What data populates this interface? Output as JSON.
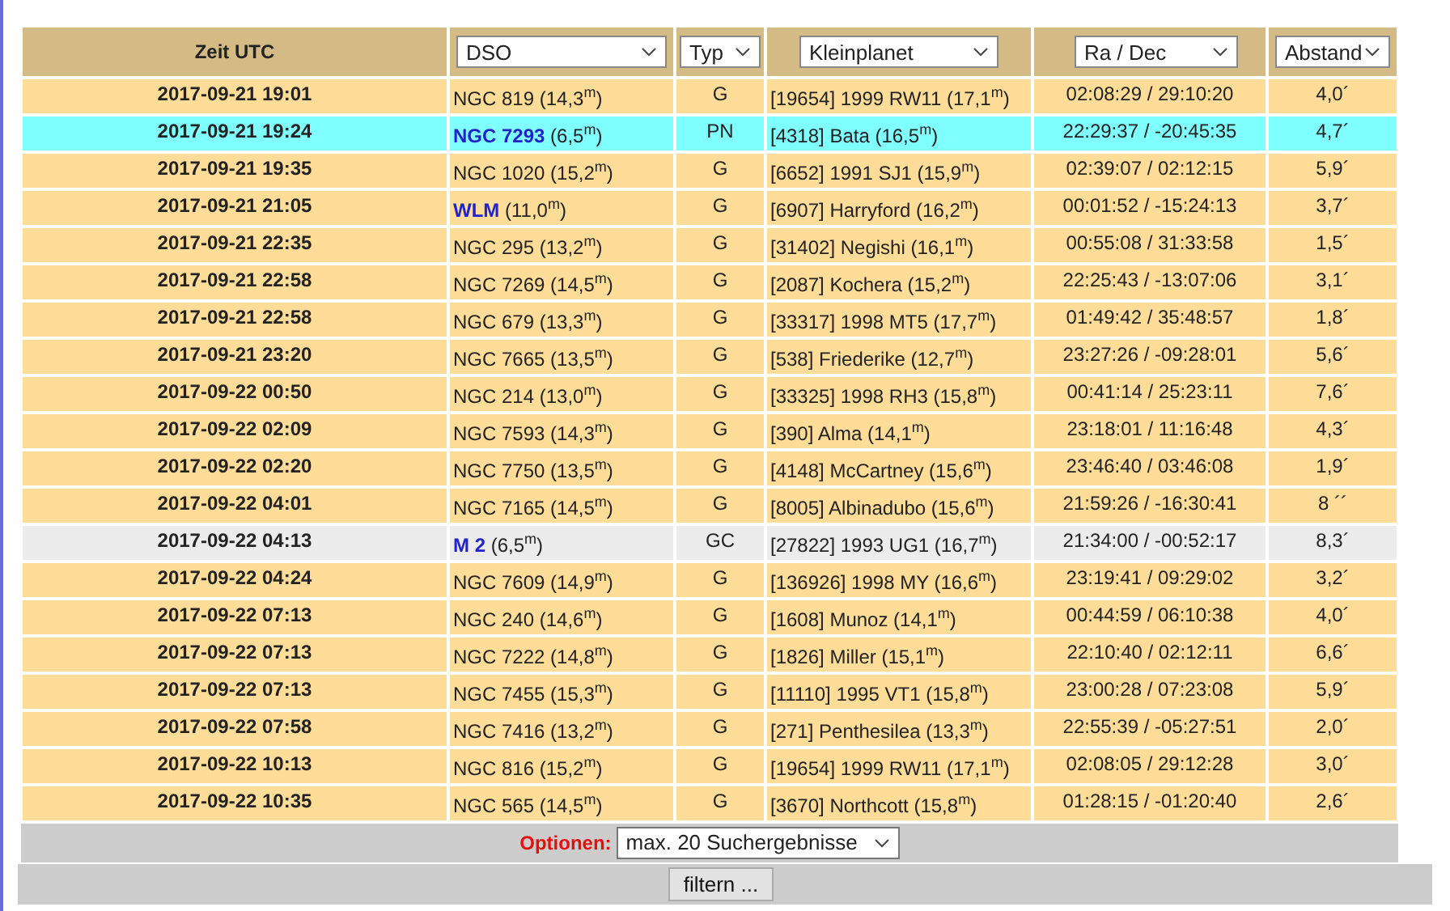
{
  "table": {
    "columns": [
      {
        "label": "Zeit UTC",
        "kind": "text"
      },
      {
        "label": "DSO",
        "kind": "select"
      },
      {
        "label": "Typ",
        "kind": "select"
      },
      {
        "label": "Kleinplanet",
        "kind": "select"
      },
      {
        "label": "Ra / Dec",
        "kind": "select"
      },
      {
        "label": "Abstand",
        "kind": "select"
      }
    ],
    "rows": [
      {
        "color": "#ffdd99",
        "time": "2017-09-21 19:01",
        "dso": {
          "name": "NGC 819",
          "mag": "(14,3$^{m}$)",
          "link": false
        },
        "type": "G",
        "planet": "[19654] 1999 RW11 (17,1$^{m}$)",
        "radec": "02:08:29 / 29:10:20",
        "distance": "4,0´"
      },
      {
        "color": "#80ffff",
        "time": "2017-09-21 19:24",
        "dso": {
          "name": "NGC 7293",
          "mag": "(6,5$^{m}$)",
          "link": true
        },
        "type": "PN",
        "planet": "[4318] Bata (16,5$^{m}$)",
        "radec": "22:29:37 / -20:45:35",
        "distance": "4,7´"
      },
      {
        "color": "#ffdd99",
        "time": "2017-09-21 19:35",
        "dso": {
          "name": "NGC 1020",
          "mag": "(15,2$^{m}$)",
          "link": false
        },
        "type": "G",
        "planet": "[6652] 1991 SJ1 (15,9$^{m}$)",
        "radec": "02:39:07 / 02:12:15",
        "distance": "5,9´"
      },
      {
        "color": "#ffdd99",
        "time": "2017-09-21 21:05",
        "dso": {
          "name": "WLM",
          "mag": "(11,0$^{m}$)",
          "link": true
        },
        "type": "G",
        "planet": "[6907] Harryford (16,2$^{m}$)",
        "radec": "00:01:52 / -15:24:13",
        "distance": "3,7´"
      },
      {
        "color": "#ffdd99",
        "time": "2017-09-21 22:35",
        "dso": {
          "name": "NGC 295",
          "mag": "(13,2$^{m}$)",
          "link": false
        },
        "type": "G",
        "planet": "[31402] Negishi (16,1$^{m}$)",
        "radec": "00:55:08 / 31:33:58",
        "distance": "1,5´"
      },
      {
        "color": "#ffdd99",
        "time": "2017-09-21 22:58",
        "dso": {
          "name": "NGC 7269",
          "mag": "(14,5$^{m}$)",
          "link": false
        },
        "type": "G",
        "planet": "[2087] Kochera (15,2$^{m}$)",
        "radec": "22:25:43 / -13:07:06",
        "distance": "3,1´"
      },
      {
        "color": "#ffdd99",
        "time": "2017-09-21 22:58",
        "dso": {
          "name": "NGC 679",
          "mag": "(13,3$^{m}$)",
          "link": false
        },
        "type": "G",
        "planet": "[33317] 1998 MT5 (17,7$^{m}$)",
        "radec": "01:49:42 / 35:48:57",
        "distance": "1,8´"
      },
      {
        "color": "#ffdd99",
        "time": "2017-09-21 23:20",
        "dso": {
          "name": "NGC 7665",
          "mag": "(13,5$^{m}$)",
          "link": false
        },
        "type": "G",
        "planet": "[538] Friederike (12,7$^{m}$)",
        "radec": "23:27:26 / -09:28:01",
        "distance": "5,6´"
      },
      {
        "color": "#ffdd99",
        "time": "2017-09-22 00:50",
        "dso": {
          "name": "NGC 214",
          "mag": "(13,0$^{m}$)",
          "link": false
        },
        "type": "G",
        "planet": "[33325] 1998 RH3 (15,8$^{m}$)",
        "radec": "00:41:14 / 25:23:11",
        "distance": "7,6´"
      },
      {
        "color": "#ffdd99",
        "time": "2017-09-22 02:09",
        "dso": {
          "name": "NGC 7593",
          "mag": "(14,3$^{m}$)",
          "link": false
        },
        "type": "G",
        "planet": "[390] Alma (14,1$^{m}$)",
        "radec": "23:18:01 / 11:16:48",
        "distance": "4,3´"
      },
      {
        "color": "#ffdd99",
        "time": "2017-09-22 02:20",
        "dso": {
          "name": "NGC 7750",
          "mag": "(13,5$^{m}$)",
          "link": false
        },
        "type": "G",
        "planet": "[4148] McCartney (15,6$^{m}$)",
        "radec": "23:46:40 / 03:46:08",
        "distance": "1,9´"
      },
      {
        "color": "#ffdd99",
        "time": "2017-09-22 04:01",
        "dso": {
          "name": "NGC 7165",
          "mag": "(14,5$^{m}$)",
          "link": false
        },
        "type": "G",
        "planet": "[8005] Albinadubo (15,6$^{m}$)",
        "radec": "21:59:26 / -16:30:41",
        "distance": "8 ´´"
      },
      {
        "color": "#ececec",
        "time": "2017-09-22 04:13",
        "dso": {
          "name": "M 2",
          "mag": "(6,5$^{m}$)",
          "link": true
        },
        "type": "GC",
        "planet": "[27822] 1993 UG1 (16,7$^{m}$)",
        "radec": "21:34:00 / -00:52:17",
        "distance": "8,3´"
      },
      {
        "color": "#ffdd99",
        "time": "2017-09-22 04:24",
        "dso": {
          "name": "NGC 7609",
          "mag": "(14,9$^{m}$)",
          "link": false
        },
        "type": "G",
        "planet": "[136926] 1998 MY (16,6$^{m}$)",
        "radec": "23:19:41 / 09:29:02",
        "distance": "3,2´"
      },
      {
        "color": "#ffdd99",
        "time": "2017-09-22 07:13",
        "dso": {
          "name": "NGC 240",
          "mag": "(14,6$^{m}$)",
          "link": false
        },
        "type": "G",
        "planet": "[1608] Munoz (14,1$^{m}$)",
        "radec": "00:44:59 / 06:10:38",
        "distance": "4,0´"
      },
      {
        "color": "#ffdd99",
        "time": "2017-09-22 07:13",
        "dso": {
          "name": "NGC 7222",
          "mag": "(14,8$^{m}$)",
          "link": false
        },
        "type": "G",
        "planet": "[1826] Miller (15,1$^{m}$)",
        "radec": "22:10:40 / 02:12:11",
        "distance": "6,6´"
      },
      {
        "color": "#ffdd99",
        "time": "2017-09-22 07:13",
        "dso": {
          "name": "NGC 7455",
          "mag": "(15,3$^{m}$)",
          "link": false
        },
        "type": "G",
        "planet": "[11110] 1995 VT1 (15,8$^{m}$)",
        "radec": "23:00:28 / 07:23:08",
        "distance": "5,9´"
      },
      {
        "color": "#ffdd99",
        "time": "2017-09-22 07:58",
        "dso": {
          "name": "NGC 7416",
          "mag": "(13,2$^{m}$)",
          "link": false
        },
        "type": "G",
        "planet": "[271] Penthesilea (13,3$^{m}$)",
        "radec": "22:55:39 / -05:27:51",
        "distance": "2,0´"
      },
      {
        "color": "#ffdd99",
        "time": "2017-09-22 10:13",
        "dso": {
          "name": "NGC 816",
          "mag": "(15,2$^{m}$)",
          "link": false
        },
        "type": "G",
        "planet": "[19654] 1999 RW11 (17,1$^{m}$)",
        "radec": "02:08:05 / 29:12:28",
        "distance": "3,0´"
      },
      {
        "color": "#ffdd99",
        "time": "2017-09-22 10:35",
        "dso": {
          "name": "NGC 565",
          "mag": "(14,5$^{m}$)",
          "link": false
        },
        "type": "G",
        "planet": "[3670] Northcott (15,8$^{m}$)",
        "radec": "01:28:15 / -01:20:40",
        "distance": "2,6´"
      }
    ]
  },
  "options": {
    "label": "Optionen:",
    "value": "max. 20 Suchergebnisse"
  },
  "filter_button": "filtern ..."
}
